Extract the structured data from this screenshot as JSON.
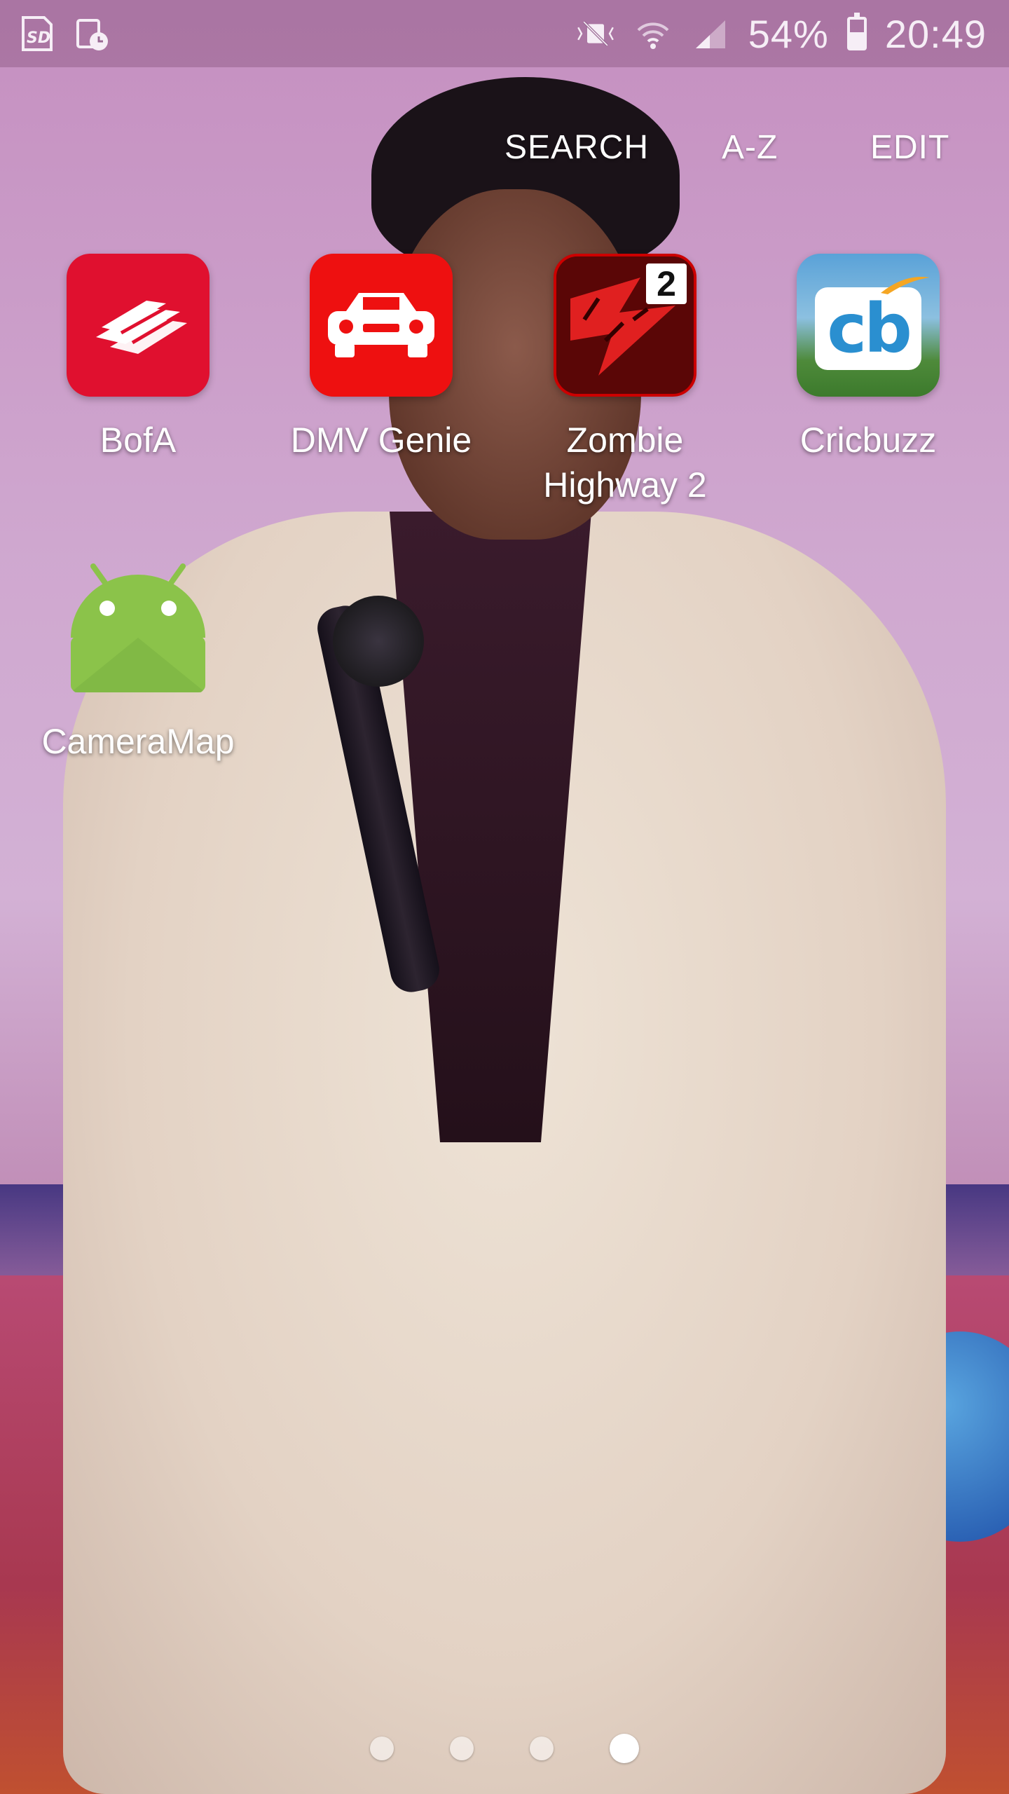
{
  "status_bar": {
    "left_icons": [
      "sd-card-icon",
      "screenshot-clock-icon"
    ],
    "right_icons": [
      "vibrate-mute-icon",
      "wifi-icon",
      "signal-icon"
    ],
    "battery_percent": "54%",
    "battery_level": 0.54,
    "time": "20:49"
  },
  "top_actions": {
    "search": "SEARCH",
    "az": "A-Z",
    "edit": "EDIT"
  },
  "apps": [
    {
      "label": "BofA",
      "icon": "bofa-flag-icon",
      "color": "#e0102f"
    },
    {
      "label": "DMV Genie",
      "icon": "car-icon",
      "color": "#ee1010"
    },
    {
      "label": "Zombie\nHighway 2",
      "icon": "zombie-highway-icon",
      "badge": "2",
      "color": "#7a0a0a"
    },
    {
      "label": "Cricbuzz",
      "icon": "cricbuzz-icon",
      "badge_text": "cb",
      "color": "#2a8fd0"
    },
    {
      "label": "CameraMap",
      "icon": "android-icon",
      "color": "#8bc34a"
    }
  ],
  "page_indicator": {
    "pages": 4,
    "current": 4
  }
}
